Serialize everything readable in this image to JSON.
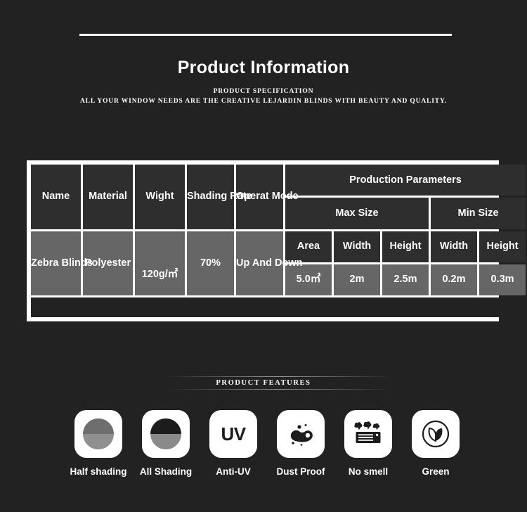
{
  "header": {
    "title": "Product Information",
    "subtitle_line1": "PRODUCT SPECIFICATION",
    "subtitle_line2": "ALL YOUR WINDOW NEEDS ARE THE CREATIVE LEJARDIN BLINDS WITH BEAUTY AND QUALITY."
  },
  "table": {
    "headers_left": [
      "Name",
      "Material",
      "Wight",
      "Shading Rate",
      "Operat Mode"
    ],
    "group_header": "Production Parameters",
    "subgroups": [
      "Max Size",
      "Min Size"
    ],
    "size_headers": [
      "Area",
      "Width",
      "Height",
      "Width",
      "Height"
    ],
    "row_left": {
      "name": "Zebra Blinds",
      "material": "Polyester",
      "wight": "120g/㎡",
      "shading_rate": "70%",
      "operat_mode": "Up And Down"
    },
    "row_sizes": [
      "5.0㎡",
      "2m",
      "2.5m",
      "0.2m",
      "0.3m"
    ]
  },
  "features_banner": {
    "label": "PRODUCT FEATURES"
  },
  "features": [
    {
      "label": "Half shading",
      "icon": "half-shading-circle-icon"
    },
    {
      "label": "All Shading",
      "icon": "all-shading-circle-icon"
    },
    {
      "label": "Anti-UV",
      "icon": "uv-icon",
      "text": "UV"
    },
    {
      "label": "Dust Proof",
      "icon": "dust-mite-icon"
    },
    {
      "label": "No smell",
      "icon": "odor-vent-icon"
    },
    {
      "label": "Green",
      "icon": "leaf-circle-icon"
    }
  ],
  "colors": {
    "background": "#222222",
    "table_border": "#ffffff",
    "header_cell": "#2e2e2e",
    "data_cell": "#666666",
    "text": "#ffffff"
  }
}
